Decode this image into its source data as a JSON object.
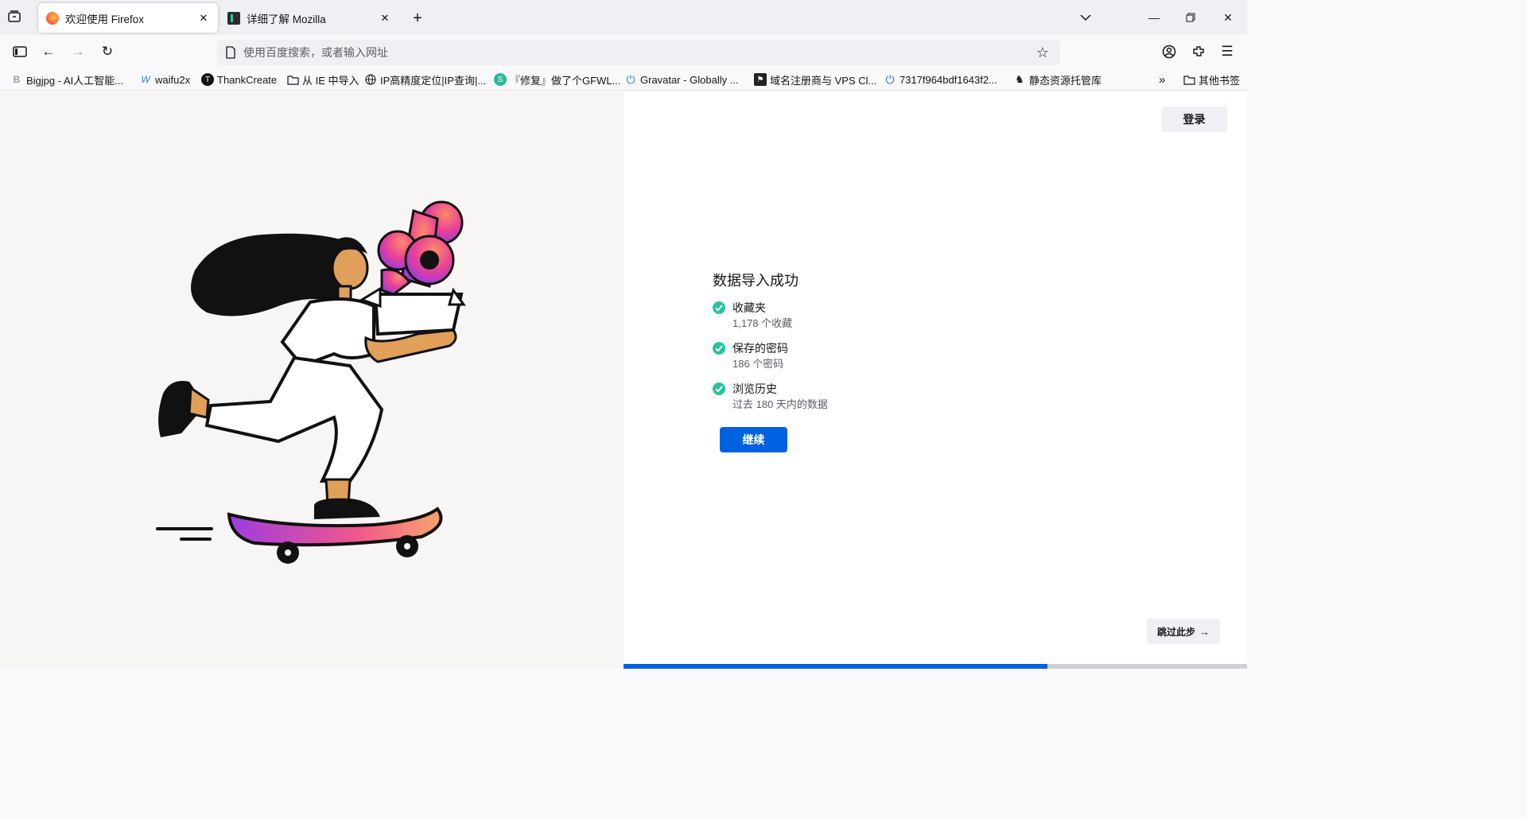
{
  "tabs": [
    {
      "label": "欢迎使用 Firefox",
      "icon": "firefox-icon",
      "active": true
    },
    {
      "label": "详细了解 Mozilla",
      "icon": "mozilla-icon",
      "active": false
    }
  ],
  "urlbar": {
    "placeholder": "使用百度搜索，或者输入网址"
  },
  "bookmarks": [
    {
      "label": "Bigjpg - AI人工智能...",
      "icon": "B"
    },
    {
      "label": "waifu2x",
      "icon": "W"
    },
    {
      "label": "ThankCreate",
      "icon": "T"
    },
    {
      "label": "从 IE 中导入",
      "icon": "folder"
    },
    {
      "label": "IP高精度定位|IP查询|...",
      "icon": "globe"
    },
    {
      "label": "『修复』做了个GFWL...",
      "icon": "S"
    },
    {
      "label": "Gravatar - Globally ...",
      "icon": "power"
    },
    {
      "label": "域名注册商与 VPS Cl...",
      "icon": "flag"
    },
    {
      "label": "7317f964bdf1643f2...",
      "icon": "power"
    },
    {
      "label": "静态资源托管库",
      "icon": "deer"
    }
  ],
  "other_bookmarks": "其他书签",
  "page": {
    "signin": "登录",
    "heading": "数据导入成功",
    "items": [
      {
        "title": "收藏夹",
        "sub": "1,178 个收藏"
      },
      {
        "title": "保存的密码",
        "sub": "186 个密码"
      },
      {
        "title": "浏览历史",
        "sub": "过去 180 天内的数据"
      }
    ],
    "continue": "继续",
    "skip": "跳过此步",
    "progress": 0.68
  },
  "colors": {
    "accent": "#0061e0",
    "check": "#2ac3a2"
  }
}
